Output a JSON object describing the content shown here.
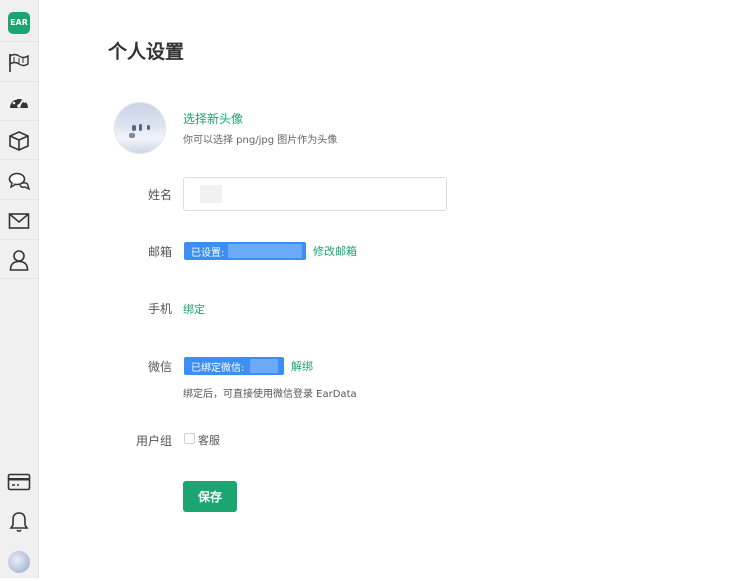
{
  "sidebar": {
    "logo_text": "EAR",
    "items": [
      {
        "icon": "flag-icon"
      },
      {
        "icon": "dashboard-icon"
      },
      {
        "icon": "box-icon"
      },
      {
        "icon": "chat-icon"
      },
      {
        "icon": "mail-icon"
      },
      {
        "icon": "user-icon"
      }
    ],
    "bottom": [
      {
        "icon": "card-icon"
      },
      {
        "icon": "bell-icon"
      },
      {
        "icon": "avatar"
      }
    ]
  },
  "page": {
    "title": "个人设置"
  },
  "avatar": {
    "choose_label": "选择新头像",
    "hint": "你可以选择 png/jpg 图片作为头像"
  },
  "fields": {
    "name_label": "姓名",
    "name_value": "",
    "email_label": "邮箱",
    "email_status": "已设置:",
    "email_modify": "修改邮箱",
    "phone_label": "手机",
    "phone_bind": "绑定",
    "wechat_label": "微信",
    "wechat_status": "已绑定微信:",
    "wechat_unbind": "解绑",
    "wechat_hint": "绑定后，可直接使用微信登录 EarData",
    "group_label": "用户组",
    "group_option": "客服",
    "group_checked": false
  },
  "actions": {
    "save_label": "保存"
  },
  "colors": {
    "accent": "#1ba571",
    "pill_blue": "#3d8ef2",
    "sidebar_bg": "#f0f0f0"
  }
}
